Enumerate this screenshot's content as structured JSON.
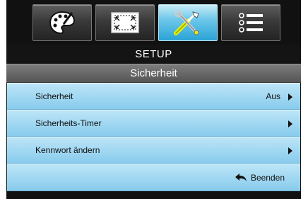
{
  "tabs": [
    {
      "icon": "palette-icon",
      "active": false
    },
    {
      "icon": "screen-resize-icon",
      "active": false
    },
    {
      "icon": "tools-icon",
      "active": true
    },
    {
      "icon": "list-icon",
      "active": false
    }
  ],
  "header": {
    "title": "SETUP",
    "subtitle": "Sicherheit"
  },
  "items": [
    {
      "label": "Sicherheit",
      "value": "Aus"
    },
    {
      "label": "Sicherheits-Timer",
      "value": ""
    },
    {
      "label": "Kennwort ändern",
      "value": ""
    }
  ],
  "exit": {
    "label": "Beenden",
    "icon": "back-arrow-icon"
  },
  "colors": {
    "active_tab": "#2aa3d6",
    "row_bg": "#a2d8f2",
    "frame_bg": "#111111"
  }
}
